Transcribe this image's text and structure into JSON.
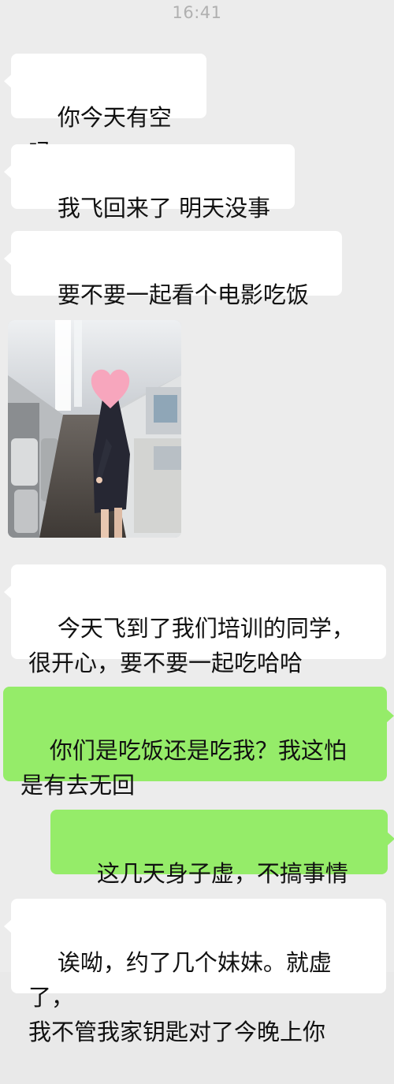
{
  "status_bar": {
    "time": "16:41"
  },
  "messages": [
    {
      "side": "received",
      "type": "text",
      "text": "你今天有空吗"
    },
    {
      "side": "received",
      "type": "text",
      "text": "我飞回来了 明天没事"
    },
    {
      "side": "received",
      "type": "text",
      "text": "要不要一起看个电影吃饭"
    },
    {
      "side": "received",
      "type": "image",
      "subject": "cabin-aisle-photo"
    },
    {
      "side": "received",
      "type": "text",
      "text": "今天飞到了我们培训的同学，\n很开心，要不要一起吃哈哈"
    },
    {
      "side": "sent",
      "type": "text",
      "text": "你们是吃饭还是吃我？我这怕\n是有去无回"
    },
    {
      "side": "sent",
      "type": "text",
      "text": "这几天身子虚，不搞事情"
    },
    {
      "side": "received",
      "type": "text",
      "text": "诶呦，约了几个妹妹。就虚了，\n我不管我家钥匙对了今晚上你"
    }
  ],
  "colors": {
    "background": "#ececec",
    "received_bubble": "#ffffff",
    "sent_bubble": "#95ec69",
    "heart_sticker": "#f7a6bd"
  }
}
